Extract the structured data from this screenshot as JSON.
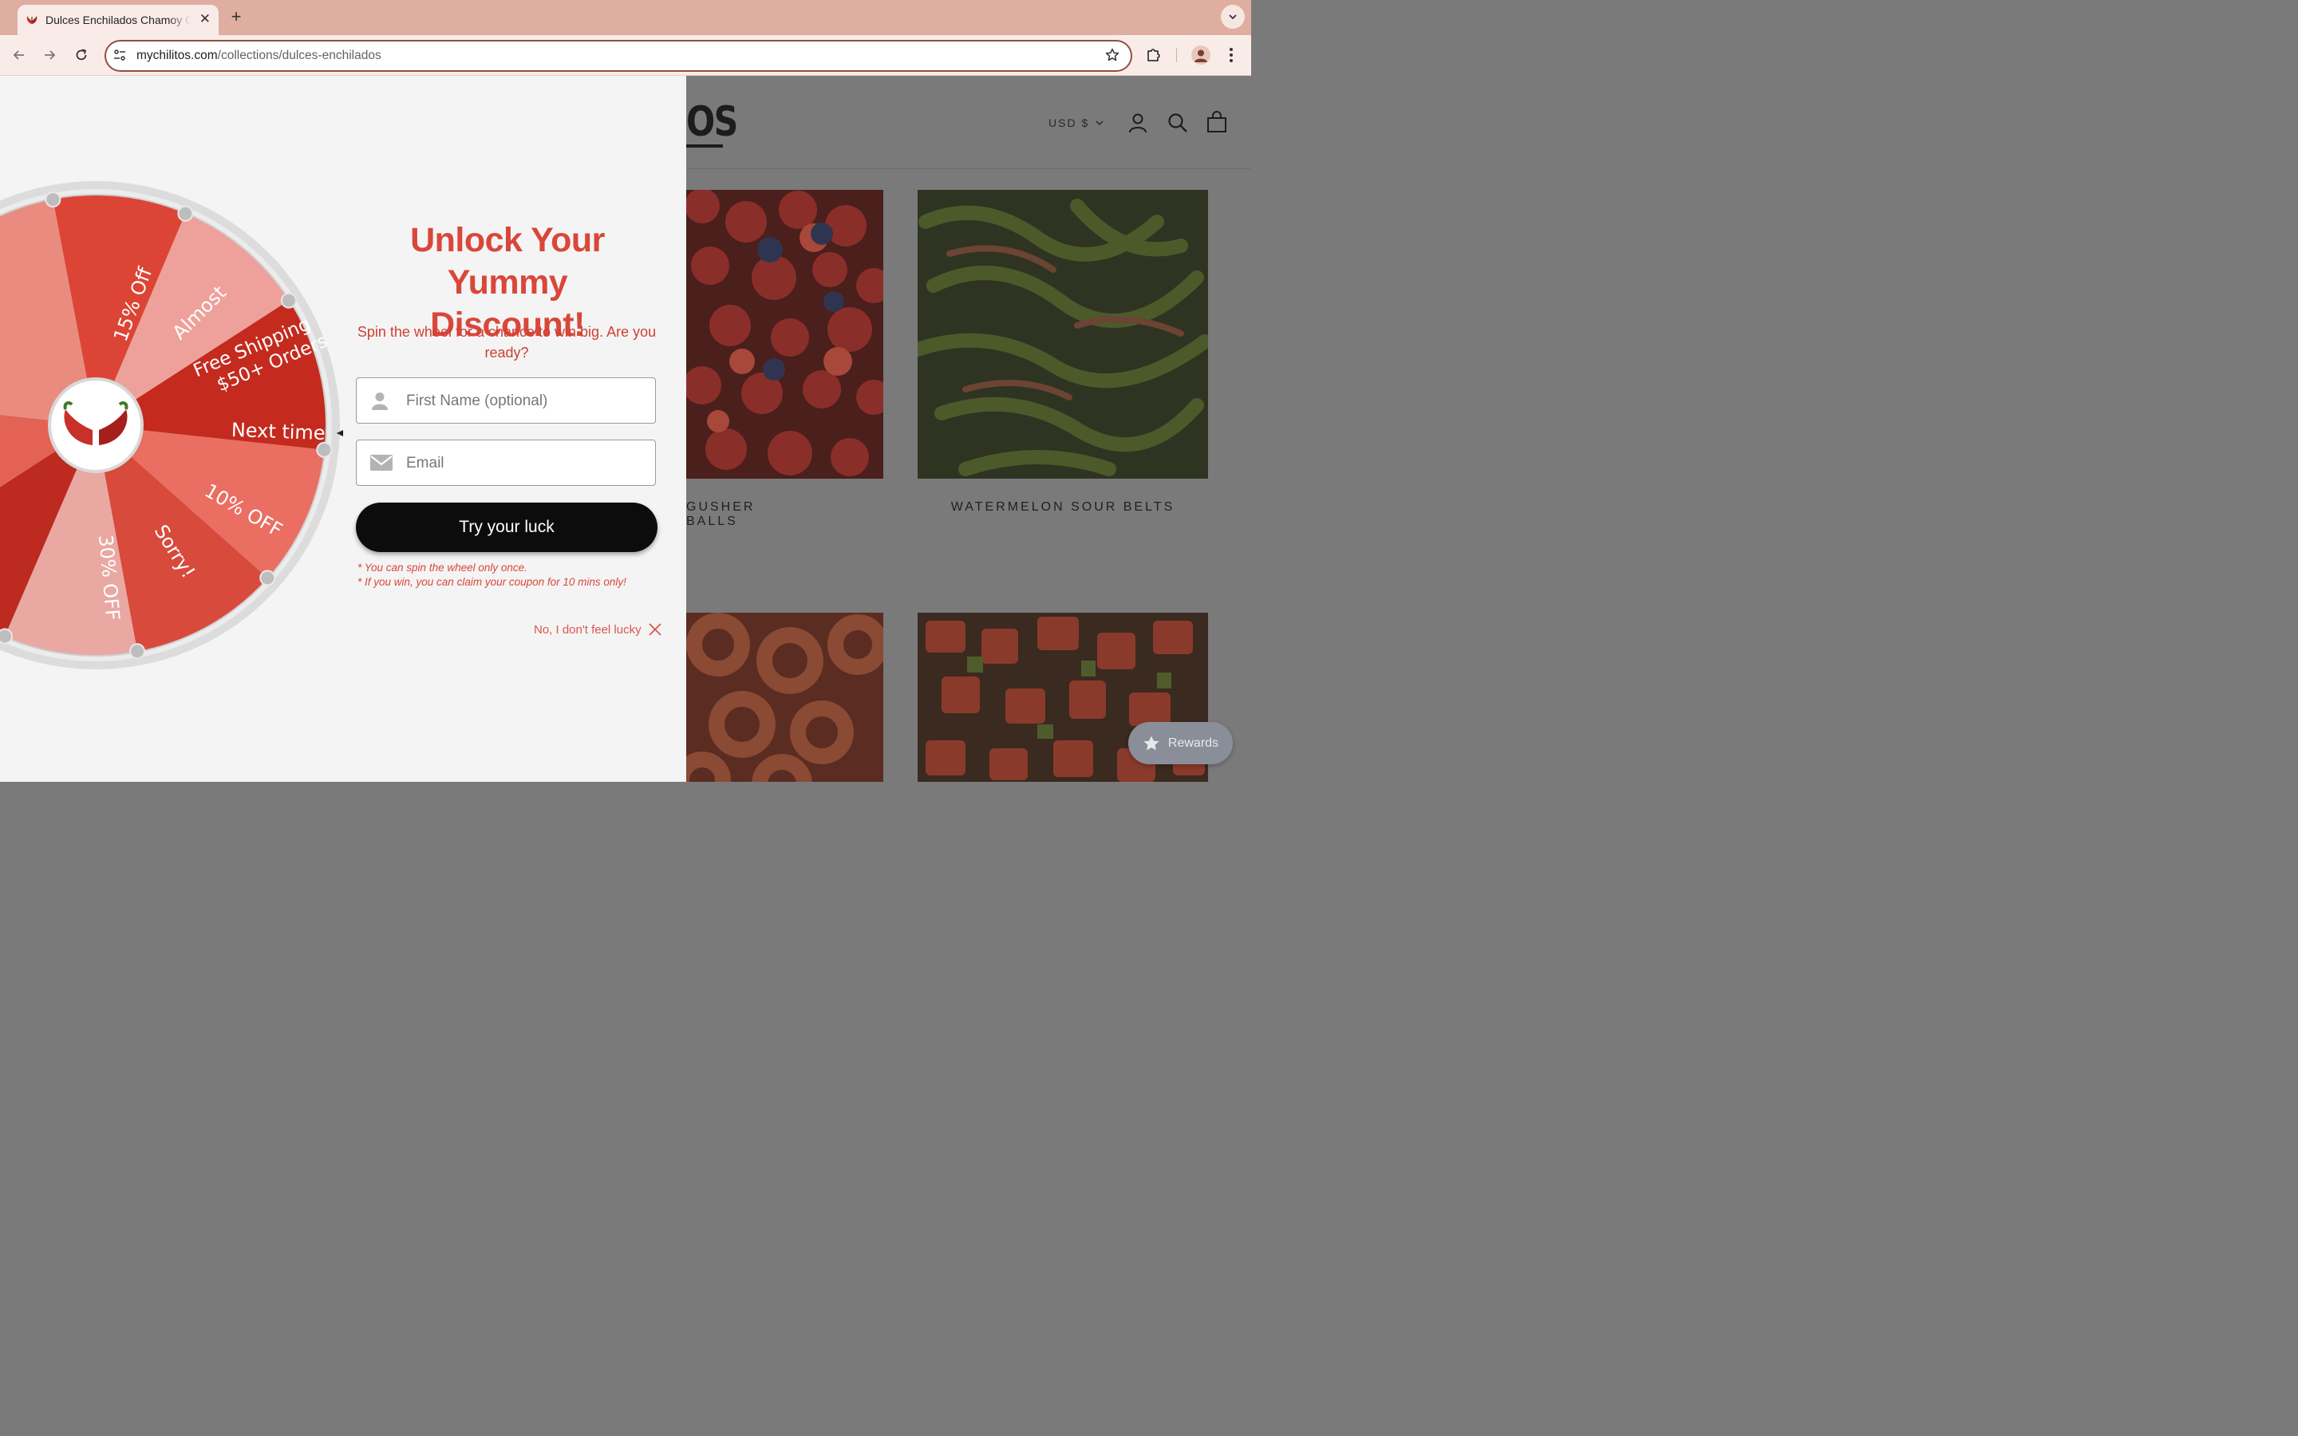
{
  "browser": {
    "tab_title": "Dulces Enchilados Chamoy Candy",
    "url_domain": "mychilitos.com",
    "url_path": "/collections/dulces-enchilados"
  },
  "store": {
    "logo_fragment": "OS",
    "currency": "USD $",
    "products": [
      {
        "name": "GUSHER BALLS"
      },
      {
        "name": "WATERMELON SOUR BELTS"
      }
    ],
    "rewards_label": "Rewards"
  },
  "popup": {
    "headline_line1": "Unlock Your Yummy",
    "headline_line2": "Discount!",
    "subtitle": "Spin the wheel for a chance to win big. Are you ready?",
    "first_name_placeholder": "First Name (optional)",
    "email_placeholder": "Email",
    "button_label": "Try your luck",
    "note1": "* You can spin the wheel only once.",
    "note2": "* If you win, you can claim your coupon for 10 mins only!",
    "decline_label": "No, I don't feel lucky",
    "wheel_segments": [
      "15% Off",
      "Almost",
      "Free Shipping",
      "$50+ Orders",
      "Next time",
      "10% OFF",
      "Sorry!",
      "30% OFF"
    ]
  }
}
